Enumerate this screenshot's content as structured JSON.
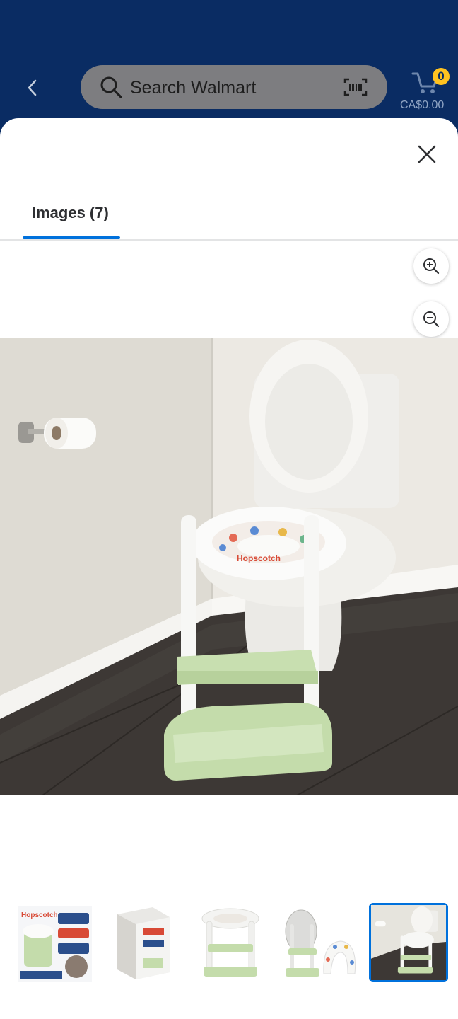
{
  "header": {
    "back_icon": "chevron-left-icon",
    "search_placeholder": "Search Walmart",
    "search_icon": "search-icon",
    "scan_icon": "barcode-scan-icon",
    "cart_icon": "cart-icon",
    "cart_count": "0",
    "cart_total": "CA$0.00",
    "brand_color": "#0a2c63",
    "badge_color": "#ffc220"
  },
  "modal": {
    "close_icon": "close-icon",
    "tab_label": "Images (7)",
    "accent_color": "#0071dc"
  },
  "viewer": {
    "zoom_in_icon": "zoom-in-icon",
    "zoom_out_icon": "zoom-out-icon",
    "main_image": "toilet-with-potty-training-ladder-seat"
  },
  "thumbnails": [
    {
      "name": "thumbnail-box-front",
      "selected": false
    },
    {
      "name": "thumbnail-box-angle",
      "selected": false
    },
    {
      "name": "thumbnail-ladder-seat",
      "selected": false
    },
    {
      "name": "thumbnail-folded-seat",
      "selected": false
    },
    {
      "name": "thumbnail-in-bathroom",
      "selected": true
    }
  ]
}
